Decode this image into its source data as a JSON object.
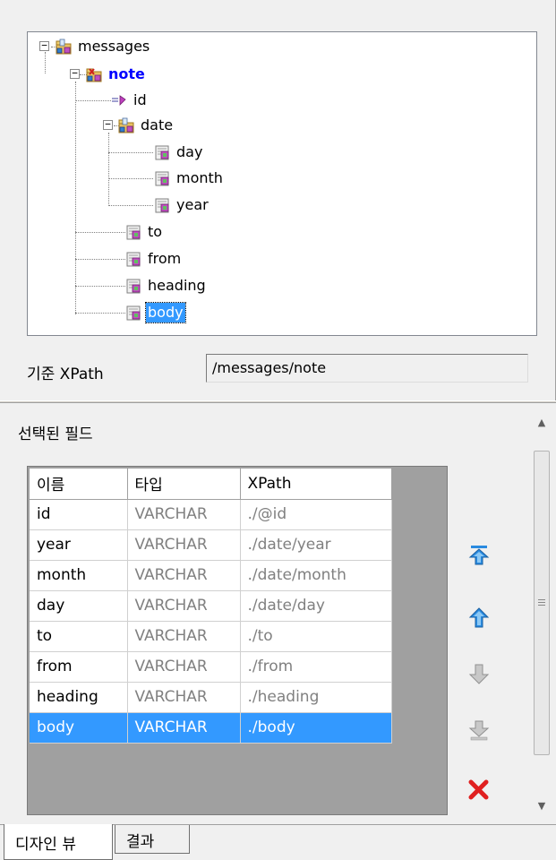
{
  "tree": {
    "nodes": [
      {
        "label": "messages"
      },
      {
        "label": "note"
      },
      {
        "label": "id"
      },
      {
        "label": "date"
      },
      {
        "label": "day"
      },
      {
        "label": "month"
      },
      {
        "label": "year"
      },
      {
        "label": "to"
      },
      {
        "label": "from"
      },
      {
        "label": "heading"
      },
      {
        "label": "body"
      }
    ]
  },
  "base_xpath": {
    "label": "기준 XPath",
    "value": "/messages/note"
  },
  "selected_fields": {
    "title": "선택된 필드",
    "columns": [
      "이름",
      "타입",
      "XPath"
    ],
    "rows": [
      {
        "name": "id",
        "type": "VARCHAR",
        "xpath": "./@id"
      },
      {
        "name": "year",
        "type": "VARCHAR",
        "xpath": "./date/year"
      },
      {
        "name": "month",
        "type": "VARCHAR",
        "xpath": "./date/month"
      },
      {
        "name": "day",
        "type": "VARCHAR",
        "xpath": "./date/day"
      },
      {
        "name": "to",
        "type": "VARCHAR",
        "xpath": "./to"
      },
      {
        "name": "from",
        "type": "VARCHAR",
        "xpath": "./from"
      },
      {
        "name": "heading",
        "type": "VARCHAR",
        "xpath": "./heading"
      },
      {
        "name": "body",
        "type": "VARCHAR",
        "xpath": "./body"
      }
    ],
    "selected_row": "body"
  },
  "side_buttons": [
    "move-top-icon",
    "move-up-icon",
    "move-down-icon",
    "move-bottom-icon",
    "delete-icon"
  ],
  "tabs": [
    {
      "label": "디자인 뷰",
      "active": true
    },
    {
      "label": "결과",
      "active": false
    }
  ],
  "colors": {
    "selection": "#3399ff",
    "root_element_text": "#0000ff",
    "arrow_blue": "#2a8be0",
    "delete_red": "#e02020"
  }
}
